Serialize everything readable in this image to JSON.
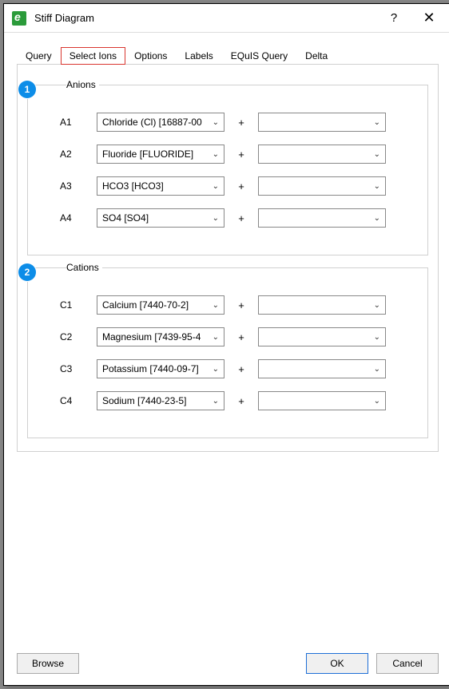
{
  "window": {
    "title": "Stiff Diagram"
  },
  "tabs": {
    "query": "Query",
    "select_ions": "Select Ions",
    "options": "Options",
    "labels": "Labels",
    "equis_query": "EQuIS Query",
    "delta": "Delta"
  },
  "anions": {
    "legend": "Anions",
    "marker": "1",
    "rows": {
      "a1": {
        "label": "A1",
        "value1": "Chloride (Cl) [16887-00",
        "value2": ""
      },
      "a2": {
        "label": "A2",
        "value1": "Fluoride [FLUORIDE]",
        "value2": ""
      },
      "a3": {
        "label": "A3",
        "value1": "HCO3 [HCO3]",
        "value2": ""
      },
      "a4": {
        "label": "A4",
        "value1": "SO4 [SO4]",
        "value2": ""
      }
    }
  },
  "cations": {
    "legend": "Cations",
    "marker": "2",
    "rows": {
      "c1": {
        "label": "C1",
        "value1": "Calcium [7440-70-2]",
        "value2": ""
      },
      "c2": {
        "label": "C2",
        "value1": "Magnesium [7439-95-4",
        "value2": ""
      },
      "c3": {
        "label": "C3",
        "value1": "Potassium [7440-09-7]",
        "value2": ""
      },
      "c4": {
        "label": "C4",
        "value1": "Sodium [7440-23-5]",
        "value2": ""
      }
    }
  },
  "symbols": {
    "plus": "+"
  },
  "footer": {
    "browse": "Browse",
    "ok": "OK",
    "cancel": "Cancel"
  }
}
